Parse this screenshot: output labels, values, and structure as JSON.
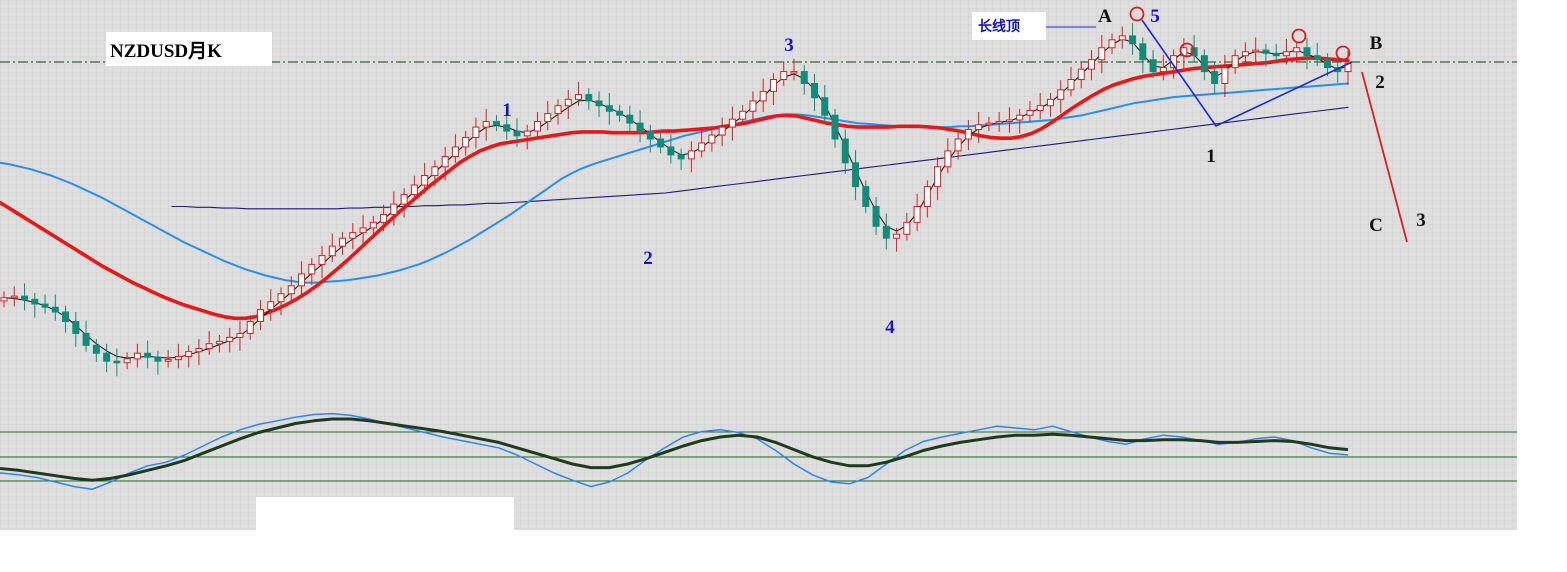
{
  "chart_data": {
    "type": "candlestick",
    "title": "NZDUSD月K",
    "annotation_long_top": "长线顶",
    "background": "#e6e6e6",
    "grid": true,
    "colors": {
      "up": "#d42020",
      "down": "#138a7a",
      "ma_thin": "#111111",
      "ma_red": "#e51919",
      "ma_blue": "#2a8fe6",
      "ma_navy": "#1d1d7a",
      "wave_blue_label": "#1515c8",
      "wave_black_label": "#111111",
      "pattern_line": "#1a2bd8",
      "projection_line": "#d42020",
      "osc_fast": "#2f86e8",
      "osc_slow": "#1f3b1f",
      "osc_level": "#2c6a2c",
      "resistance": "#2f6a3a"
    },
    "price_series": [
      0.63,
      0.632,
      0.628,
      0.622,
      0.618,
      0.612,
      0.6,
      0.585,
      0.57,
      0.56,
      0.55,
      0.548,
      0.553,
      0.56,
      0.555,
      0.55,
      0.552,
      0.556,
      0.562,
      0.566,
      0.572,
      0.575,
      0.58,
      0.585,
      0.6,
      0.615,
      0.625,
      0.635,
      0.645,
      0.66,
      0.672,
      0.683,
      0.695,
      0.705,
      0.712,
      0.718,
      0.725,
      0.735,
      0.748,
      0.76,
      0.772,
      0.784,
      0.795,
      0.808,
      0.82,
      0.832,
      0.845,
      0.852,
      0.848,
      0.84,
      0.834,
      0.84,
      0.852,
      0.862,
      0.872,
      0.88,
      0.886,
      0.878,
      0.872,
      0.865,
      0.86,
      0.85,
      0.84,
      0.83,
      0.82,
      0.81,
      0.805,
      0.815,
      0.825,
      0.835,
      0.845,
      0.855,
      0.865,
      0.878,
      0.89,
      0.905,
      0.915,
      0.915,
      0.9,
      0.882,
      0.86,
      0.83,
      0.8,
      0.77,
      0.745,
      0.72,
      0.705,
      0.71,
      0.725,
      0.745,
      0.77,
      0.795,
      0.815,
      0.83,
      0.842,
      0.848,
      0.85,
      0.852,
      0.854,
      0.86,
      0.866,
      0.872,
      0.88,
      0.892,
      0.905,
      0.918,
      0.93,
      0.945,
      0.955,
      0.96,
      0.95,
      0.93,
      0.915,
      0.92,
      0.935,
      0.945,
      0.935,
      0.915,
      0.9,
      0.92,
      0.935,
      0.94,
      0.942,
      0.938,
      0.935,
      0.94,
      0.945,
      0.935,
      0.93,
      0.92,
      0.915,
      0.925
    ],
    "ma_thin": [
      0.63,
      0.629,
      0.627,
      0.624,
      0.62,
      0.614,
      0.606,
      0.595,
      0.583,
      0.572,
      0.563,
      0.556,
      0.554,
      0.555,
      0.556,
      0.555,
      0.554,
      0.555,
      0.558,
      0.562,
      0.566,
      0.571,
      0.576,
      0.582,
      0.592,
      0.604,
      0.615,
      0.626,
      0.637,
      0.649,
      0.661,
      0.672,
      0.684,
      0.695,
      0.704,
      0.712,
      0.72,
      0.729,
      0.74,
      0.752,
      0.764,
      0.776,
      0.788,
      0.8,
      0.812,
      0.824,
      0.836,
      0.845,
      0.847,
      0.845,
      0.84,
      0.838,
      0.843,
      0.852,
      0.861,
      0.87,
      0.878,
      0.879,
      0.875,
      0.869,
      0.863,
      0.855,
      0.846,
      0.836,
      0.826,
      0.817,
      0.81,
      0.812,
      0.82,
      0.829,
      0.839,
      0.849,
      0.859,
      0.871,
      0.883,
      0.897,
      0.908,
      0.912,
      0.906,
      0.892,
      0.873,
      0.848,
      0.82,
      0.791,
      0.764,
      0.739,
      0.72,
      0.714,
      0.721,
      0.737,
      0.759,
      0.782,
      0.803,
      0.82,
      0.834,
      0.843,
      0.848,
      0.851,
      0.853,
      0.857,
      0.863,
      0.869,
      0.876,
      0.887,
      0.899,
      0.912,
      0.924,
      0.938,
      0.949,
      0.956,
      0.952,
      0.937,
      0.922,
      0.92,
      0.93,
      0.94,
      0.936,
      0.922,
      0.908,
      0.915,
      0.928,
      0.936,
      0.94,
      0.939,
      0.937,
      0.939,
      0.942,
      0.937,
      0.932,
      0.924,
      0.918,
      0.922
    ],
    "ma_red": [
      0.75,
      0.742,
      0.734,
      0.726,
      0.718,
      0.71,
      0.702,
      0.694,
      0.686,
      0.678,
      0.67,
      0.663,
      0.656,
      0.649,
      0.643,
      0.637,
      0.631,
      0.626,
      0.621,
      0.617,
      0.613,
      0.609,
      0.606,
      0.604,
      0.604,
      0.606,
      0.61,
      0.615,
      0.621,
      0.628,
      0.636,
      0.645,
      0.655,
      0.666,
      0.677,
      0.689,
      0.701,
      0.713,
      0.725,
      0.737,
      0.748,
      0.759,
      0.77,
      0.78,
      0.79,
      0.8,
      0.808,
      0.815,
      0.82,
      0.824,
      0.826,
      0.828,
      0.83,
      0.832,
      0.834,
      0.836,
      0.838,
      0.839,
      0.839,
      0.839,
      0.838,
      0.838,
      0.838,
      0.838,
      0.839,
      0.84,
      0.84,
      0.841,
      0.842,
      0.843,
      0.844,
      0.846,
      0.848,
      0.85,
      0.853,
      0.856,
      0.859,
      0.86,
      0.859,
      0.856,
      0.853,
      0.85,
      0.848,
      0.846,
      0.845,
      0.845,
      0.845,
      0.845,
      0.846,
      0.846,
      0.846,
      0.845,
      0.844,
      0.842,
      0.84,
      0.837,
      0.834,
      0.832,
      0.831,
      0.831,
      0.833,
      0.837,
      0.843,
      0.851,
      0.86,
      0.869,
      0.877,
      0.885,
      0.892,
      0.898,
      0.902,
      0.906,
      0.909,
      0.911,
      0.913,
      0.915,
      0.917,
      0.919,
      0.92,
      0.921,
      0.922,
      0.923,
      0.924,
      0.925,
      0.926,
      0.928,
      0.93,
      0.931,
      0.932,
      0.932,
      0.931,
      0.93,
      0.929
    ],
    "ma_blue": [
      0.8,
      0.798,
      0.795,
      0.792,
      0.788,
      0.784,
      0.779,
      0.774,
      0.768,
      0.762,
      0.756,
      0.749,
      0.742,
      0.735,
      0.728,
      0.721,
      0.714,
      0.707,
      0.7,
      0.694,
      0.688,
      0.682,
      0.676,
      0.671,
      0.666,
      0.662,
      0.658,
      0.655,
      0.652,
      0.65,
      0.649,
      0.649,
      0.65,
      0.651,
      0.652,
      0.654,
      0.656,
      0.658,
      0.661,
      0.664,
      0.668,
      0.672,
      0.677,
      0.683,
      0.689,
      0.696,
      0.703,
      0.711,
      0.719,
      0.727,
      0.735,
      0.744,
      0.753,
      0.762,
      0.771,
      0.78,
      0.787,
      0.793,
      0.798,
      0.802,
      0.806,
      0.81,
      0.814,
      0.818,
      0.822,
      0.826,
      0.83,
      0.834,
      0.837,
      0.84,
      0.843,
      0.846,
      0.849,
      0.852,
      0.855,
      0.858,
      0.86,
      0.861,
      0.861,
      0.86,
      0.858,
      0.856,
      0.854,
      0.852,
      0.85,
      0.849,
      0.848,
      0.847,
      0.846,
      0.845,
      0.845,
      0.845,
      0.845,
      0.845,
      0.846,
      0.846,
      0.847,
      0.848,
      0.849,
      0.85,
      0.851,
      0.852,
      0.853,
      0.854,
      0.856,
      0.858,
      0.86,
      0.863,
      0.866,
      0.869,
      0.872,
      0.875,
      0.877,
      0.879,
      0.881,
      0.883,
      0.884,
      0.885,
      0.886,
      0.887,
      0.888,
      0.889,
      0.89,
      0.891,
      0.892,
      0.893,
      0.894,
      0.895,
      0.896,
      0.897,
      0.898,
      0.899,
      0.9
    ],
    "ma_navy": [
      0.745,
      0.745,
      0.744,
      0.744,
      0.743,
      0.743,
      0.742,
      0.742,
      0.742,
      0.742,
      0.742,
      0.742,
      0.742,
      0.742,
      0.743,
      0.743,
      0.744,
      0.744,
      0.745,
      0.745,
      0.746,
      0.746,
      0.747,
      0.747,
      0.748,
      0.749,
      0.749,
      0.75,
      0.751,
      0.752,
      0.753,
      0.754,
      0.755,
      0.756,
      0.757,
      0.758,
      0.759,
      0.76,
      0.761,
      0.762,
      0.764,
      0.766,
      0.768,
      0.77,
      0.772,
      0.774,
      0.776,
      0.778,
      0.78,
      0.782,
      0.784,
      0.786,
      0.788,
      0.79,
      0.792,
      0.794,
      0.796,
      0.798,
      0.8,
      0.802,
      0.804,
      0.806,
      0.808,
      0.81,
      0.812,
      0.814,
      0.816,
      0.818,
      0.82,
      0.822,
      0.824,
      0.826,
      0.828,
      0.83,
      0.832,
      0.834,
      0.836,
      0.838,
      0.84,
      0.842,
      0.844,
      0.846,
      0.848,
      0.85,
      0.852,
      0.854,
      0.856,
      0.858,
      0.86,
      0.862,
      0.864,
      0.866,
      0.868,
      0.87
    ],
    "osc_fast": [
      0.3,
      0.28,
      0.25,
      0.2,
      0.15,
      0.12,
      0.2,
      0.3,
      0.38,
      0.42,
      0.5,
      0.6,
      0.7,
      0.78,
      0.84,
      0.88,
      0.92,
      0.95,
      0.96,
      0.94,
      0.9,
      0.85,
      0.8,
      0.75,
      0.7,
      0.66,
      0.62,
      0.58,
      0.5,
      0.4,
      0.3,
      0.22,
      0.15,
      0.2,
      0.3,
      0.45,
      0.58,
      0.7,
      0.76,
      0.78,
      0.75,
      0.68,
      0.55,
      0.4,
      0.28,
      0.2,
      0.18,
      0.25,
      0.4,
      0.55,
      0.65,
      0.7,
      0.74,
      0.78,
      0.82,
      0.8,
      0.78,
      0.82,
      0.76,
      0.7,
      0.65,
      0.62,
      0.68,
      0.72,
      0.7,
      0.66,
      0.62,
      0.64,
      0.68,
      0.7,
      0.66,
      0.58,
      0.52,
      0.5
    ],
    "osc_slow": [
      0.35,
      0.33,
      0.3,
      0.27,
      0.24,
      0.22,
      0.24,
      0.28,
      0.33,
      0.38,
      0.44,
      0.52,
      0.6,
      0.68,
      0.75,
      0.8,
      0.85,
      0.88,
      0.9,
      0.9,
      0.88,
      0.85,
      0.82,
      0.79,
      0.76,
      0.72,
      0.68,
      0.64,
      0.58,
      0.52,
      0.46,
      0.4,
      0.36,
      0.36,
      0.4,
      0.46,
      0.53,
      0.6,
      0.66,
      0.7,
      0.72,
      0.7,
      0.64,
      0.56,
      0.48,
      0.42,
      0.38,
      0.38,
      0.42,
      0.48,
      0.55,
      0.6,
      0.64,
      0.67,
      0.7,
      0.72,
      0.72,
      0.73,
      0.72,
      0.7,
      0.68,
      0.66,
      0.66,
      0.67,
      0.67,
      0.66,
      0.64,
      0.64,
      0.65,
      0.66,
      0.65,
      0.62,
      0.58,
      0.56
    ],
    "wave_labels_blue": [
      "1",
      "2",
      "3",
      "4",
      "5"
    ],
    "wave_labels_black": [
      "A",
      "B",
      "C",
      "1",
      "2",
      "3"
    ]
  }
}
